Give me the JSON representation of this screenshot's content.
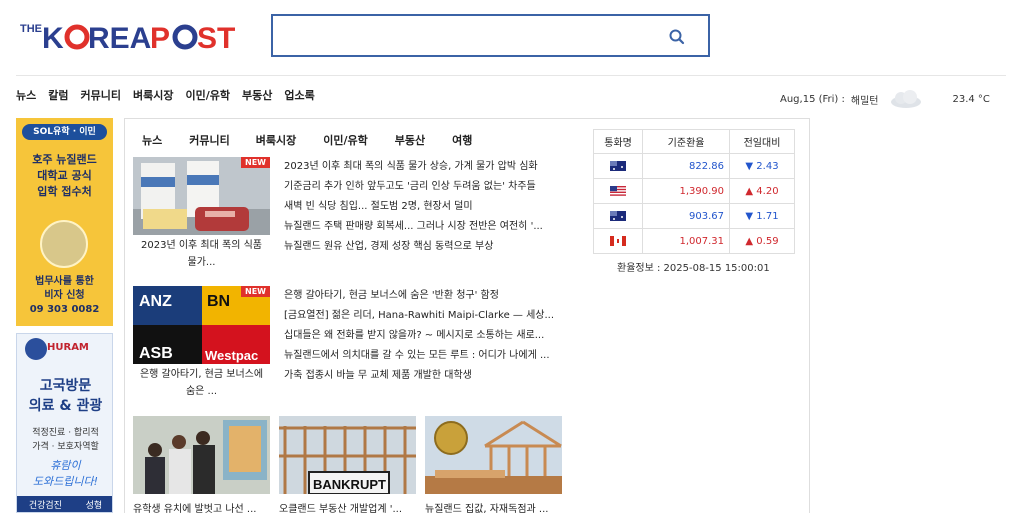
{
  "header": {
    "logo_the": "THE",
    "logo_korea": "K",
    "logo_orea": "REA",
    "logo_post": "P",
    "logo_st": "ST",
    "search": {
      "value": "",
      "placeholder": ""
    }
  },
  "gnb": [
    "뉴스",
    "칼럼",
    "커뮤니티",
    "벼룩시장",
    "이민/유학",
    "부동산",
    "업소록"
  ],
  "weather": {
    "date": "Aug,15 (Fri) :",
    "city": "해밀턴",
    "icon": "cloud-icon",
    "temp": "23.4 °C"
  },
  "ads": {
    "ad1": {
      "pill": "SOL유학 · 이민",
      "headline": [
        "호주 뉴질랜드",
        "대학교 공식",
        "입학 접수처"
      ],
      "sub": [
        "법무사를 통한",
        "비자 신청"
      ],
      "phone": "09 303 0082"
    },
    "ad2": {
      "brand": "HURAM",
      "headline": [
        "고국방문",
        "의료 & 관광"
      ],
      "sub": [
        "적정진료 · 합리적",
        "가격 · 보호자역할"
      ],
      "script": [
        "휴람이",
        "도와드립니다!"
      ],
      "footer": [
        "건강검진",
        "성형"
      ]
    }
  },
  "tabs": [
    "뉴스",
    "커뮤니티",
    "벼룩시장",
    "이민/유학",
    "부동산",
    "여행"
  ],
  "main": {
    "new_label": "NEW",
    "featured1": {
      "caption": [
        "2023년 이후 최대 폭의 식품",
        "물가..."
      ],
      "list": [
        "2023년 이후 최대 폭의 식품 물가 상승, 가계 물가 압박 심화",
        "기준금리 추가 인하 앞두고도 '금리 인상 두려움 없는' 차주들",
        "새벽 빈 식당 침입... 절도범 2명, 현장서 덜미",
        "뉴질랜드 주택 판매량 회복세... 그러나 시장 전반은 여전히 '...",
        "뉴질랜드 원유 산업, 경제 성장 핵심 동력으로 부상"
      ]
    },
    "featured2": {
      "caption": [
        "은행 갈아타기, 현금 보너스에",
        "숨은 ..."
      ],
      "list": [
        "은행 갈아타기, 현금 보너스에 숨은 '반환 청구' 함정",
        "[금요열전] 젊은 리더, Hana-Rawhiti Maipi-Clarke — 세상...",
        "십대들은 왜 전화를 받지 않을까? ~ 메시지로 소통하는 새로...",
        "뉴질랜드에서 의치대를 갈 수 있는 모든 루트 : 어디가 나에게 ...",
        "가축 접종시 바늘 무 교체 제품 개발한 대학생"
      ],
      "thumb_words": [
        "ANZ",
        "BN",
        "ASB",
        "Westpac"
      ]
    },
    "bottom": [
      {
        "caption": "유학생 유치에 발벗고 나선 ..."
      },
      {
        "caption": "오클랜드 부동산 개발업계 '...",
        "sign": "BANKRUPT"
      },
      {
        "caption": "뉴질랜드 집값, 자재독점과 ..."
      }
    ]
  },
  "exchange": {
    "headers": [
      "통화명",
      "기준환율",
      "전일대비"
    ],
    "rows": [
      {
        "flag": "au-flag",
        "rate": "822.86",
        "change": "▼ 2.43",
        "dir": "down"
      },
      {
        "flag": "us-flag",
        "rate": "1,390.90",
        "change": "▲ 4.20",
        "dir": "up"
      },
      {
        "flag": "au-flag",
        "rate": "903.67",
        "change": "▼ 1.71",
        "dir": "down"
      },
      {
        "flag": "ca-flag",
        "rate": "1,007.31",
        "change": "▲ 0.59",
        "dir": "up"
      }
    ],
    "info": "환율정보 : 2025-08-15 15:00:01"
  },
  "colors": {
    "brand_blue": "#2b3f8f",
    "brand_red": "#e0312b",
    "down": "#2255cc",
    "up": "#d0282e"
  }
}
